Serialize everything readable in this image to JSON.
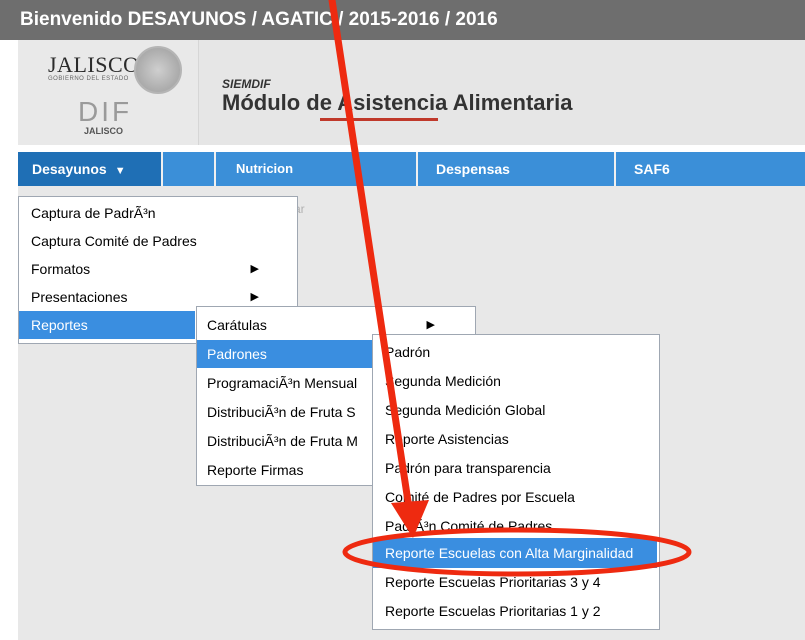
{
  "window": {
    "title": "Bienvenido DESAYUNOS / AGATIC / 2015-2016 / 2016"
  },
  "header": {
    "logo_jalisco": "JALISCO",
    "logo_gobierno": "GOBIERNO DEL ESTADO",
    "logo_dif": "DIF",
    "logo_dif_sub": "JALISCO",
    "siemdif": "SIEMDIF",
    "module_title": "Módulo de Asistencia Alimentaria"
  },
  "nav": {
    "tabs": [
      {
        "label": "Desayunos",
        "active": true
      },
      {
        "label": "Nutricion",
        "active": false
      },
      {
        "label": "Despensas",
        "active": false
      },
      {
        "label": "SAF6",
        "active": false
      }
    ],
    "faded_text": "ar"
  },
  "menu_level1": [
    {
      "label": "Captura de PadrÃ³n"
    },
    {
      "label": "Captura Comité de Padres"
    },
    {
      "label": "Formatos",
      "submenu": true
    },
    {
      "label": "Presentaciones",
      "submenu": true
    },
    {
      "label": "Reportes",
      "highlighted": true
    }
  ],
  "menu_level2": [
    {
      "label": "Carátulas",
      "submenu": true
    },
    {
      "label": "Padrones",
      "highlighted": true
    },
    {
      "label": "ProgramaciÃ³n Mensual"
    },
    {
      "label": "DistribuciÃ³n de Fruta S"
    },
    {
      "label": "DistribuciÃ³n de Fruta M"
    },
    {
      "label": "Reporte Firmas"
    }
  ],
  "menu_level3": [
    {
      "label": "Padrón"
    },
    {
      "label": "Segunda Medición"
    },
    {
      "label": "Segunda Medición Global"
    },
    {
      "label": "Reporte Asistencias"
    },
    {
      "label": "Padrón para transparencia"
    },
    {
      "label": "Comité de Padres por Escuela"
    },
    {
      "label": "PadrÃ³n Comité de Padres"
    },
    {
      "label": "Reporte Escuelas con Alta Marginalidad",
      "highlighted": true
    },
    {
      "label": "Reporte Escuelas Prioritarias 3 y 4"
    },
    {
      "label": "Reporte Escuelas Prioritarias 1 y 2"
    }
  ],
  "colors": {
    "titlebar": "#6e6e6e",
    "nav": "#3b8fd8",
    "highlight": "#3a8ee0",
    "annotation": "#ee2a10"
  },
  "icons": {
    "submenu_arrow": "triangle-right",
    "dropdown": "triangle-down"
  }
}
